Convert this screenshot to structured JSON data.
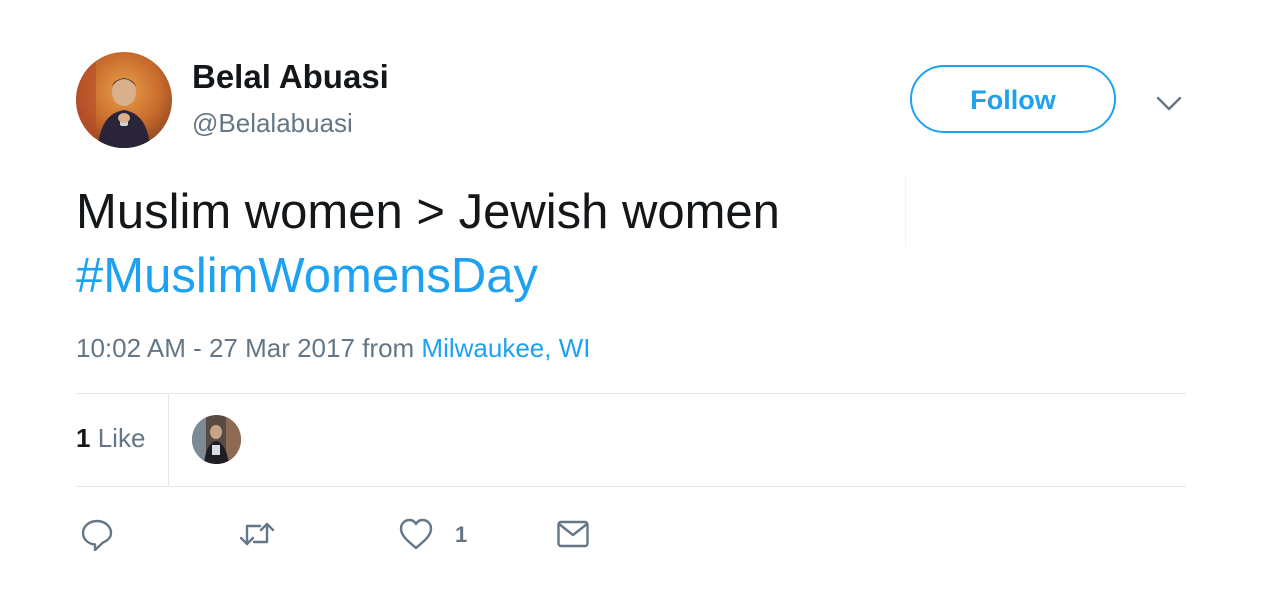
{
  "user": {
    "display_name": "Belal Abuasi",
    "screen_name": "@Belalabuasi",
    "avatar_icon": "profile-photo-avatar"
  },
  "follow_button": {
    "label": "Follow"
  },
  "caret_icon": "chevron-down-icon",
  "tweet": {
    "text": "Muslim women > Jewish women",
    "hashtag": "#MuslimWomensDay"
  },
  "meta": {
    "timestamp": "10:02 AM - 27 Mar 2017",
    "from_word": "from",
    "location": "Milwaukee, WI"
  },
  "stats": {
    "likes_count": "1",
    "likes_label": "Like"
  },
  "actions": {
    "reply_icon": "reply-icon",
    "retweet_icon": "retweet-icon",
    "like_icon": "heart-icon",
    "like_count": "1",
    "dm_icon": "envelope-icon"
  },
  "colors": {
    "accent": "#1da1f2",
    "secondary_text": "#657786",
    "primary_text": "#14171a",
    "divider": "#e1e8ed"
  }
}
